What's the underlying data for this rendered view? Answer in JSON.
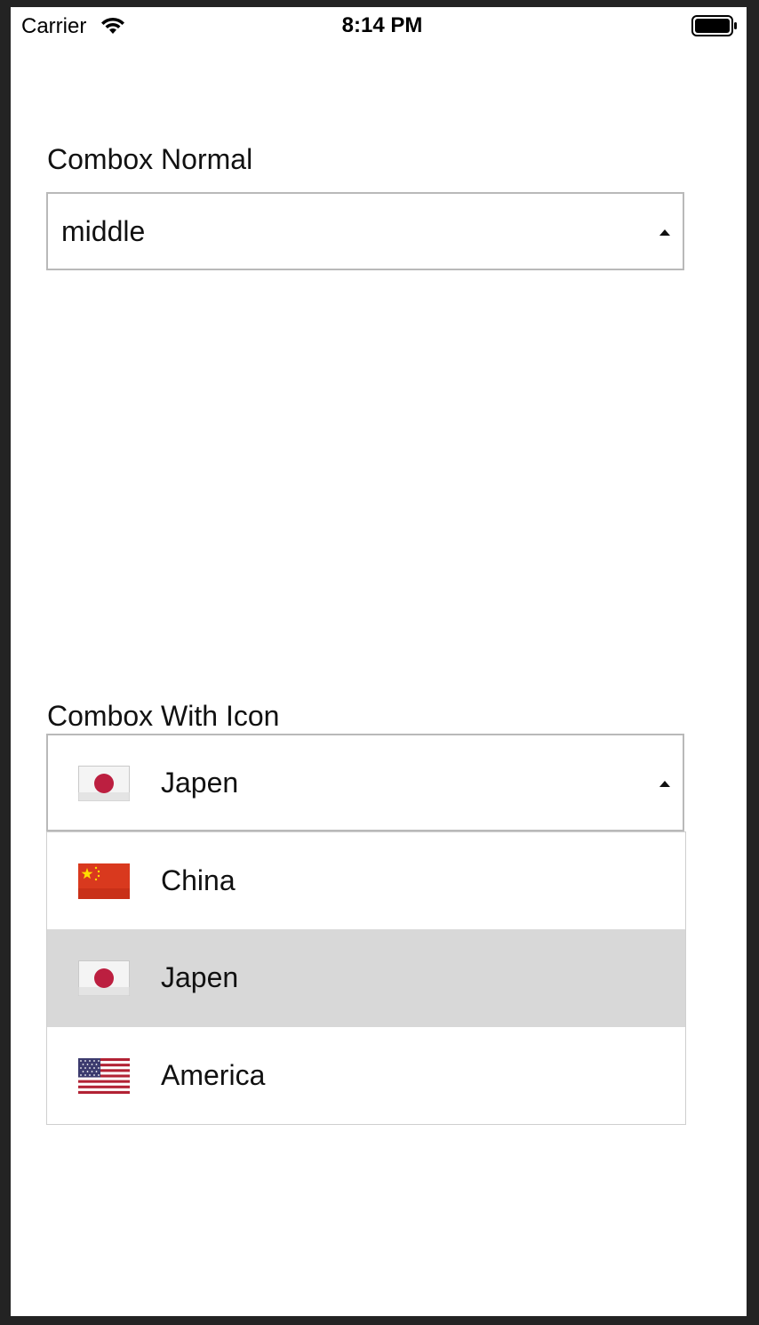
{
  "status_bar": {
    "carrier": "Carrier",
    "time": "8:14 PM",
    "wifi_icon": "wifi-icon",
    "battery_icon": "battery-icon"
  },
  "combox_normal": {
    "label": "Combox Normal",
    "value": "middle",
    "caret_icon": "caret-up-icon"
  },
  "combox_with_icon": {
    "label": "Combox With Icon",
    "selected": {
      "label": "Japen",
      "icon": "japan-flag-icon"
    },
    "caret_icon": "caret-up-icon",
    "options": [
      {
        "label": "China",
        "icon": "china-flag-icon",
        "highlighted": false
      },
      {
        "label": "Japen",
        "icon": "japan-flag-icon",
        "highlighted": true
      },
      {
        "label": "America",
        "icon": "usa-flag-icon",
        "highlighted": false
      }
    ]
  },
  "colors": {
    "frame": "#232323",
    "screen_bg": "#ffffff",
    "border": "#b9b9b9",
    "highlight": "#d8d8d8",
    "japan_red": "#bc1f40",
    "china_red": "#de2910",
    "china_star": "#ffde00",
    "usa_blue": "#3c3b6e",
    "usa_red": "#b22234"
  }
}
